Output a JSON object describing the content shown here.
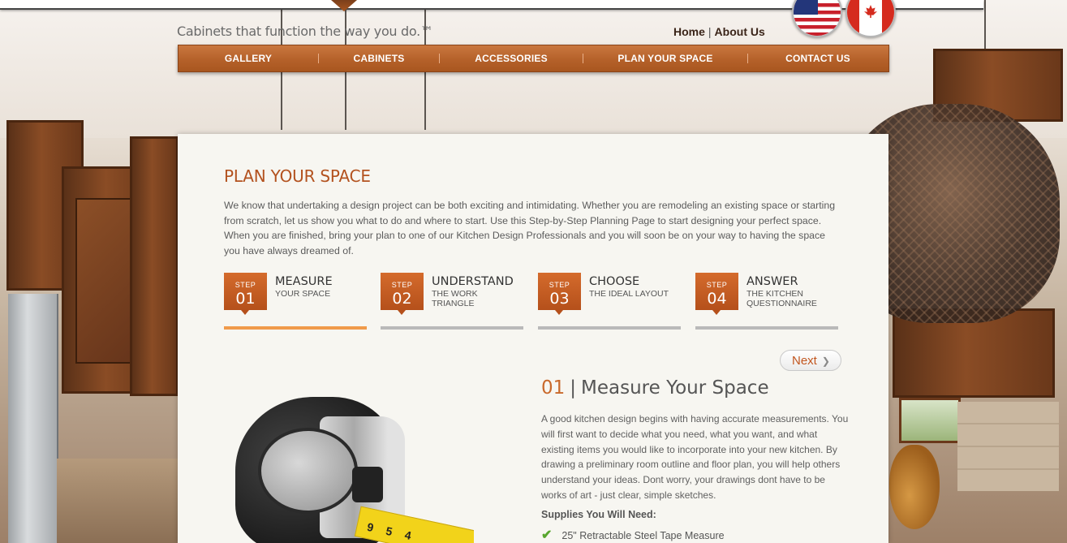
{
  "header": {
    "tagline": "Cabinets that function the way you do.™",
    "links": {
      "home": "Home",
      "separator": "|",
      "about": "About Us"
    },
    "flags": [
      "us-flag-icon",
      "canada-flag-icon"
    ]
  },
  "nav": {
    "items": [
      "GALLERY",
      "CABINETS",
      "ACCESSORIES",
      "PLAN YOUR SPACE",
      "CONTACT US"
    ],
    "separator": "|"
  },
  "page": {
    "title": "PLAN YOUR SPACE",
    "intro": "We know that undertaking a design project can be both exciting and intimidating. Whether you are remodeling an existing space or starting from scratch, let us show you what to do and where to start. Use this Step-by-Step Planning Page to start designing your perfect space. When you are finished, bring your plan to one of our Kitchen Design Professionals and you will soon be on your way to having the space you have always dreamed of."
  },
  "steps": [
    {
      "label": "STEP",
      "number": "01",
      "title": "MEASURE",
      "subtitle": "YOUR SPACE",
      "active": true
    },
    {
      "label": "STEP",
      "number": "02",
      "title": "UNDERSTAND",
      "subtitle": "THE WORK TRIANGLE",
      "active": false
    },
    {
      "label": "STEP",
      "number": "03",
      "title": "CHOOSE",
      "subtitle": "THE IDEAL LAYOUT",
      "active": false
    },
    {
      "label": "STEP",
      "number": "04",
      "title": "ANSWER",
      "subtitle": "THE KITCHEN QUESTIONNAIRE",
      "active": false
    }
  ],
  "next_button": {
    "label": "Next",
    "icon": "chevron-right-icon"
  },
  "section": {
    "number": "01",
    "separator": "|",
    "title": "Measure Your Space",
    "body": "A good kitchen design begins with having accurate measurements. You will first want to decide what you need, what you want, and what existing items you would like to incorporate into your new kitchen. By drawing a preliminary room outline and floor plan, you will help others understand your ideas. Dont worry, your drawings dont have to be works of art - just clear, simple sketches.",
    "supplies_heading": "Supplies You Will Need:",
    "supplies": [
      "25\" Retractable Steel Tape Measure"
    ],
    "supply_icon": "checkmark-icon",
    "tape_numbers": "9 5 4"
  },
  "colors": {
    "accent": "#c9692b",
    "nav": "#b5612a",
    "active_step_line": "#f09a4a",
    "inactive_step_line": "#b9b9b9",
    "check": "#58a62e"
  }
}
